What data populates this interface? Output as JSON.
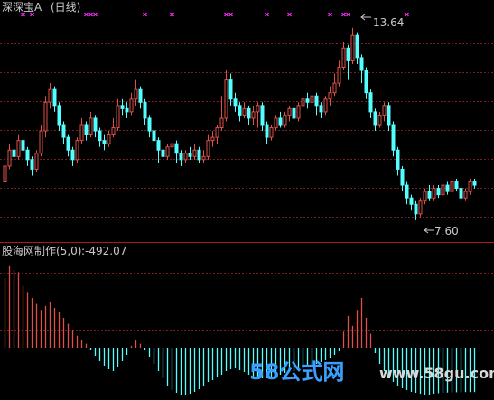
{
  "top_panel": {
    "title": "深深宝A",
    "period": "(日线)",
    "high_label": "13.64",
    "low_label": "7.60"
  },
  "bottom_panel": {
    "indicator": "股海网制作(5,0)",
    "value_label": ":-492.07"
  },
  "watermark": {
    "text_cn": "58公式网",
    "url": "www.58gu.com"
  },
  "colors": {
    "up": "#e0504a",
    "down": "#54ffff",
    "grid": "#7a1e1e",
    "divider": "#b01818",
    "signal": "#ff30ff",
    "label": "#c8c8c8",
    "watermark_blue": "#3aa0ff",
    "watermark_green": "#4fd24f"
  },
  "chart_data": [
    {
      "type": "candlestick",
      "panel": "price",
      "title": "深深宝A",
      "period": "(日线)",
      "ylim": [
        7.2,
        14.0
      ],
      "annotations": [
        {
          "text": "13.64",
          "value": 13.64
        },
        {
          "text": "7.60",
          "value": 7.6
        }
      ],
      "signal_markers": [
        4,
        6,
        18,
        19,
        20,
        31,
        37,
        49,
        50,
        58,
        63,
        72,
        75,
        76,
        89
      ],
      "candles": [
        [
          8.8,
          9.3,
          9.5,
          8.7
        ],
        [
          9.3,
          9.8,
          10.0,
          9.2
        ],
        [
          9.8,
          9.6,
          10.1,
          9.4
        ],
        [
          9.6,
          10.1,
          10.3,
          9.5
        ],
        [
          10.1,
          9.8,
          10.3,
          9.6
        ],
        [
          9.8,
          9.5,
          9.9,
          9.3
        ],
        [
          9.5,
          9.2,
          9.6,
          9.0
        ],
        [
          9.2,
          9.7,
          9.8,
          9.1
        ],
        [
          9.7,
          10.4,
          10.6,
          9.6
        ],
        [
          10.4,
          11.3,
          11.5,
          10.2
        ],
        [
          11.3,
          11.7,
          11.9,
          11.1
        ],
        [
          11.7,
          11.2,
          11.8,
          11.0
        ],
        [
          11.2,
          10.6,
          11.3,
          10.4
        ],
        [
          10.6,
          10.2,
          10.7,
          10.0
        ],
        [
          10.2,
          9.8,
          10.3,
          9.6
        ],
        [
          9.8,
          9.5,
          9.9,
          9.3
        ],
        [
          9.5,
          10.1,
          10.2,
          9.4
        ],
        [
          10.1,
          10.6,
          10.8,
          10.0
        ],
        [
          10.6,
          10.3,
          10.7,
          10.1
        ],
        [
          10.3,
          10.8,
          11.0,
          10.2
        ],
        [
          10.8,
          10.4,
          10.9,
          10.2
        ],
        [
          10.4,
          10.1,
          10.5,
          9.9
        ],
        [
          10.1,
          10.0,
          10.3,
          9.8
        ],
        [
          10.0,
          10.3,
          10.4,
          9.9
        ],
        [
          10.3,
          10.5,
          10.8,
          10.2
        ],
        [
          10.5,
          11.2,
          11.4,
          10.4
        ],
        [
          11.2,
          11.1,
          11.4,
          10.9
        ],
        [
          11.1,
          11.0,
          11.3,
          10.8
        ],
        [
          11.0,
          11.4,
          11.6,
          10.9
        ],
        [
          11.4,
          11.7,
          12.0,
          11.2
        ],
        [
          11.7,
          11.3,
          11.8,
          11.1
        ],
        [
          11.3,
          10.8,
          11.4,
          10.6
        ],
        [
          10.8,
          10.4,
          10.9,
          10.2
        ],
        [
          10.4,
          10.1,
          10.5,
          9.9
        ],
        [
          10.1,
          9.8,
          10.2,
          9.4
        ],
        [
          9.8,
          9.6,
          9.9,
          9.2
        ],
        [
          9.6,
          9.9,
          10.0,
          9.5
        ],
        [
          9.9,
          10.0,
          10.2,
          9.6
        ],
        [
          10.0,
          9.7,
          10.1,
          9.4
        ],
        [
          9.7,
          9.5,
          9.8,
          9.3
        ],
        [
          9.5,
          9.7,
          9.8,
          9.4
        ],
        [
          9.7,
          9.6,
          9.9,
          9.5
        ],
        [
          9.6,
          9.8,
          10.0,
          9.5
        ],
        [
          9.8,
          9.5,
          9.9,
          9.4
        ],
        [
          9.5,
          9.6,
          9.8,
          9.4
        ],
        [
          9.6,
          10.1,
          10.3,
          9.5
        ],
        [
          10.1,
          10.2,
          10.4,
          9.9
        ],
        [
          10.2,
          10.5,
          10.6,
          10.0
        ],
        [
          10.5,
          10.8,
          11.5,
          10.4
        ],
        [
          10.8,
          12.0,
          12.3,
          10.7
        ],
        [
          12.0,
          11.4,
          12.2,
          11.2
        ],
        [
          11.4,
          11.2,
          11.6,
          11.0
        ],
        [
          11.2,
          10.9,
          11.3,
          10.7
        ],
        [
          10.9,
          11.1,
          11.3,
          10.8
        ],
        [
          11.1,
          10.8,
          11.2,
          10.6
        ],
        [
          10.8,
          11.0,
          11.2,
          10.6
        ],
        [
          11.0,
          11.2,
          11.3,
          10.5
        ],
        [
          11.2,
          10.6,
          11.3,
          10.4
        ],
        [
          10.6,
          10.2,
          10.7,
          10.0
        ],
        [
          10.2,
          10.5,
          10.6,
          10.1
        ],
        [
          10.5,
          10.8,
          10.9,
          10.4
        ],
        [
          10.8,
          10.6,
          11.0,
          10.5
        ],
        [
          10.6,
          10.9,
          11.0,
          10.5
        ],
        [
          10.9,
          11.1,
          11.2,
          10.7
        ],
        [
          11.1,
          10.8,
          11.2,
          10.6
        ],
        [
          10.8,
          11.2,
          11.3,
          10.7
        ],
        [
          11.2,
          11.4,
          11.5,
          11.0
        ],
        [
          11.4,
          11.3,
          11.6,
          11.1
        ],
        [
          11.3,
          11.5,
          11.7,
          11.2
        ],
        [
          11.5,
          11.2,
          11.6,
          10.9
        ],
        [
          11.2,
          11.0,
          11.3,
          10.8
        ],
        [
          11.0,
          11.4,
          11.5,
          10.9
        ],
        [
          11.4,
          11.6,
          11.8,
          11.2
        ],
        [
          11.6,
          11.9,
          12.2,
          11.5
        ],
        [
          11.9,
          12.4,
          12.6,
          11.8
        ],
        [
          12.4,
          13.0,
          13.2,
          12.3
        ],
        [
          13.0,
          12.6,
          13.1,
          12.0
        ],
        [
          12.6,
          13.4,
          13.64,
          12.5
        ],
        [
          13.4,
          12.7,
          13.5,
          12.5
        ],
        [
          12.7,
          12.3,
          12.8,
          11.9
        ],
        [
          12.3,
          11.6,
          12.4,
          11.4
        ],
        [
          11.6,
          11.0,
          11.7,
          10.8
        ],
        [
          11.0,
          10.6,
          11.1,
          10.4
        ],
        [
          10.6,
          10.9,
          11.0,
          10.5
        ],
        [
          10.9,
          11.2,
          11.3,
          10.7
        ],
        [
          11.2,
          10.6,
          11.3,
          10.4
        ],
        [
          10.6,
          9.8,
          10.7,
          9.6
        ],
        [
          9.8,
          9.2,
          9.9,
          9.0
        ],
        [
          9.2,
          8.7,
          9.3,
          8.5
        ],
        [
          8.7,
          8.3,
          8.8,
          8.1
        ],
        [
          8.3,
          8.1,
          8.4,
          7.9
        ],
        [
          8.1,
          7.8,
          8.2,
          7.6
        ],
        [
          7.8,
          8.2,
          8.3,
          7.7
        ],
        [
          8.2,
          8.5,
          8.6,
          8.1
        ],
        [
          8.5,
          8.3,
          8.7,
          8.2
        ],
        [
          8.3,
          8.6,
          8.7,
          8.2
        ],
        [
          8.6,
          8.4,
          8.7,
          8.3
        ],
        [
          8.4,
          8.7,
          8.8,
          8.3
        ],
        [
          8.7,
          8.5,
          8.8,
          8.4
        ],
        [
          8.5,
          8.8,
          8.9,
          8.4
        ],
        [
          8.8,
          8.6,
          8.9,
          8.5
        ],
        [
          8.6,
          8.3,
          8.7,
          8.2
        ],
        [
          8.3,
          8.5,
          8.6,
          8.2
        ],
        [
          8.5,
          8.8,
          8.9,
          8.4
        ],
        [
          8.8,
          8.7,
          8.9,
          8.6
        ]
      ]
    },
    {
      "type": "bar",
      "panel": "indicator",
      "title": "股海网制作(5,0)",
      "latest_value": -492.07,
      "ylim": [
        -550,
        900
      ],
      "values": [
        700,
        820,
        780,
        760,
        620,
        560,
        500,
        440,
        380,
        420,
        460,
        400,
        360,
        300,
        240,
        180,
        120,
        80,
        40,
        -30,
        -90,
        -150,
        -200,
        -240,
        -260,
        -220,
        -150,
        -80,
        20,
        80,
        40,
        -30,
        -100,
        -180,
        -260,
        -340,
        -420,
        -470,
        -500,
        -520,
        -520,
        -510,
        -490,
        -460,
        -420,
        -380,
        -360,
        -330,
        -300,
        -260,
        -240,
        -230,
        -250,
        -270,
        -300,
        -320,
        -330,
        -340,
        -340,
        -330,
        -320,
        -300,
        -280,
        -270,
        -260,
        -240,
        -230,
        -220,
        -200,
        -180,
        -160,
        -140,
        -120,
        -80,
        -40,
        160,
        320,
        220,
        380,
        500,
        300,
        140,
        -60,
        -180,
        -260,
        -320,
        -380,
        -420,
        -450,
        -470,
        -490,
        -500,
        -510,
        -520,
        -520,
        -510,
        -505,
        -500,
        -498,
        -495,
        -494,
        -493,
        -492,
        -492,
        -492.07
      ]
    }
  ]
}
